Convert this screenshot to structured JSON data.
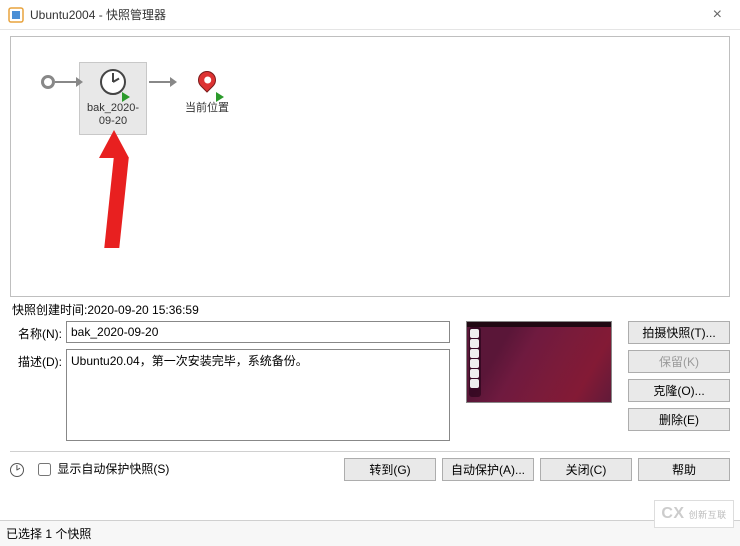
{
  "window": {
    "title": "Ubuntu2004 - 快照管理器"
  },
  "canvas": {
    "selected_snapshot_label": "bak_2020-09-20",
    "current_position_label": "当前位置"
  },
  "details": {
    "creation_line": "快照创建时间:2020-09-20 15:36:59",
    "name_label": "名称(N):",
    "name_value": "bak_2020-09-20",
    "desc_label": "描述(D):",
    "desc_value": "Ubuntu20.04，第一次安装完毕，系统备份。"
  },
  "right_buttons": {
    "take": "拍摄快照(T)...",
    "keep": "保留(K)",
    "clone": "克隆(O)...",
    "delete": "删除(E)"
  },
  "footer": {
    "auto_protect_checkbox": "显示自动保护快照(S)",
    "goto": "转到(G)",
    "auto_protect_btn": "自动保护(A)...",
    "close": "关闭(C)",
    "help": "帮助"
  },
  "status_bar": "已选择 1 个快照",
  "watermark": "创新互联"
}
